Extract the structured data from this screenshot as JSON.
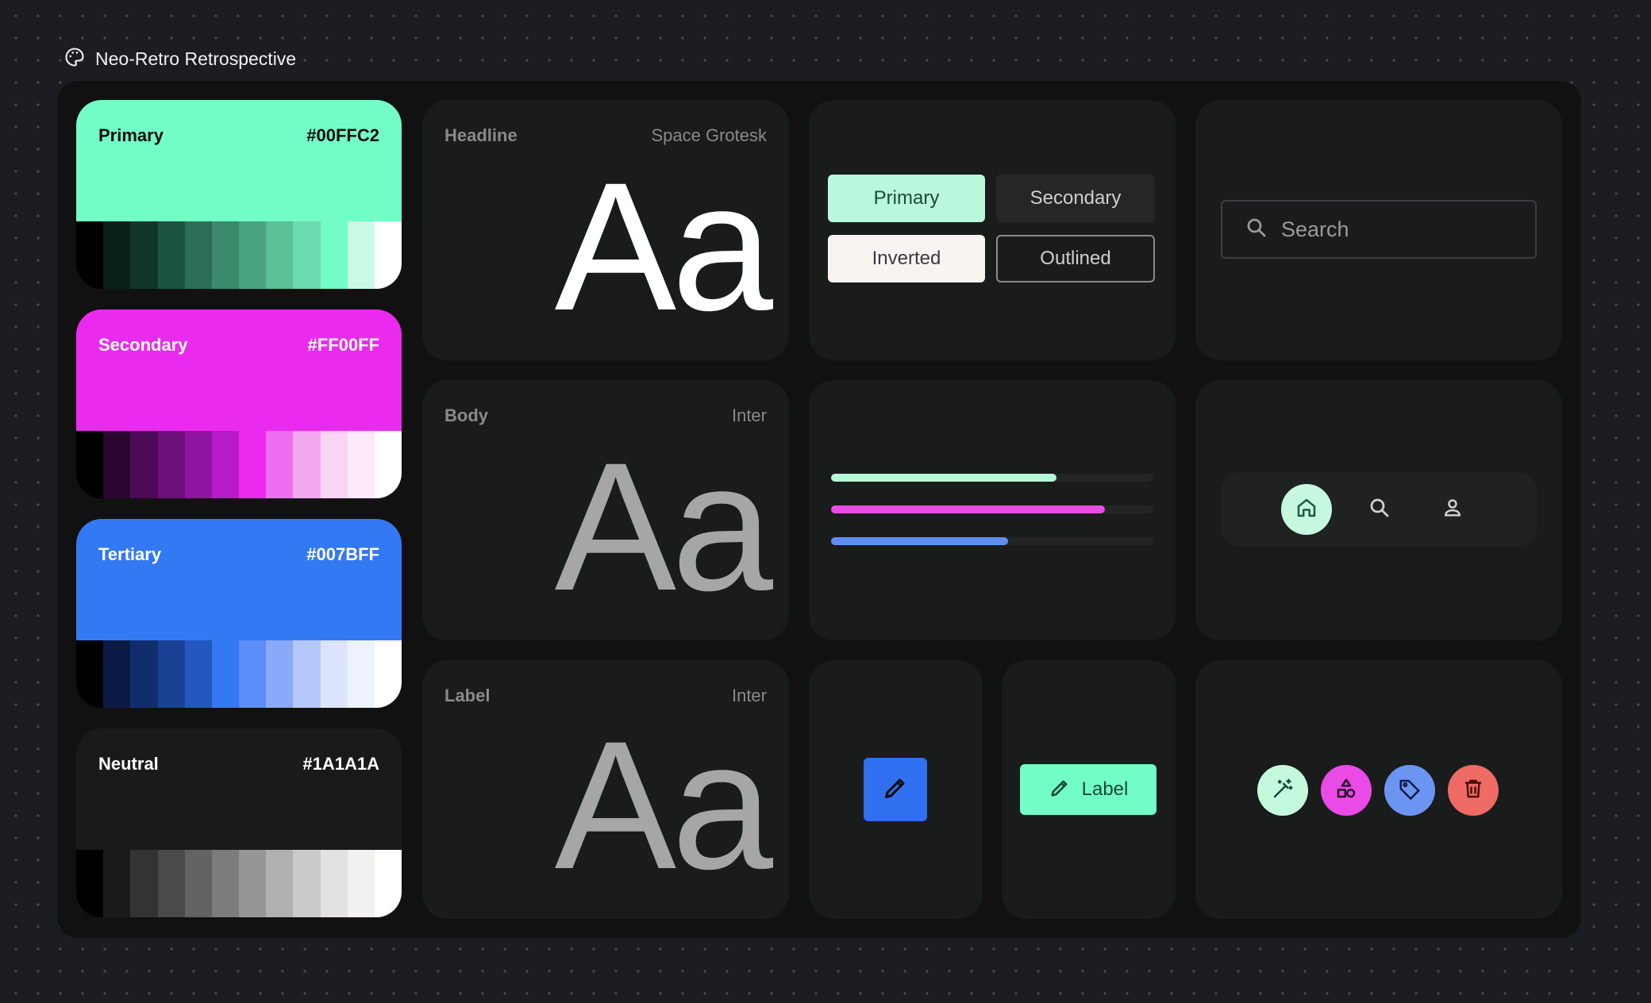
{
  "app_title": "Neo-Retro Retrospective",
  "swatches": [
    {
      "name": "Primary",
      "hex": "#00FFC2",
      "main": "#72fcc6",
      "text": "#0d0d0d",
      "tones": [
        "#000000",
        "#082017",
        "#11352a",
        "#1d5441",
        "#2c6f56",
        "#3a8a6b",
        "#4aa380",
        "#5ac095",
        "#6cdcb0",
        "#72fcc6",
        "#c9fbe6",
        "#ffffff"
      ]
    },
    {
      "name": "Secondary",
      "hex": "#FF00FF",
      "main": "#eb2af0",
      "text": "#ffffff",
      "tones": [
        "#000000",
        "#2a0630",
        "#4b0a56",
        "#6d0f7a",
        "#8f15a0",
        "#b51cc7",
        "#eb2af0",
        "#ef6df0",
        "#f3a9f0",
        "#f8d4f5",
        "#fceafa",
        "#ffffff"
      ]
    },
    {
      "name": "Tertiary",
      "hex": "#007BFF",
      "main": "#3479f4",
      "text": "#ffffff",
      "tones": [
        "#000000",
        "#0b1b45",
        "#112d6c",
        "#1a4093",
        "#2458be",
        "#3479f4",
        "#5c8df8",
        "#8aa9fa",
        "#b6c8fb",
        "#dce4fd",
        "#eef2fe",
        "#ffffff"
      ]
    },
    {
      "name": "Neutral",
      "hex": "#1A1A1A",
      "main": "#1a1a1a",
      "text": "#ffffff",
      "tones": [
        "#000000",
        "#1a1a1a",
        "#333333",
        "#4a4a4a",
        "#636363",
        "#7c7c7c",
        "#969696",
        "#b0b0b0",
        "#cacaca",
        "#e4e2e1",
        "#f3f1f0",
        "#ffffff"
      ]
    }
  ],
  "typography": [
    {
      "label": "Headline",
      "font": "Space Grotesk",
      "sample": "Aa",
      "color": "#ffffff"
    },
    {
      "label": "Body",
      "font": "Inter",
      "sample": "Aa",
      "color": "#a6a6a6"
    },
    {
      "label": "Label",
      "font": "Inter",
      "sample": "Aa",
      "color": "#a6a6a6"
    }
  ],
  "buttons": {
    "primary": "Primary",
    "secondary": "Secondary",
    "inverted": "Inverted",
    "outlined": "Outlined"
  },
  "search": {
    "placeholder": "Search",
    "icon": "search-icon"
  },
  "progress": [
    {
      "value": 0.7,
      "color": "#b6f7d8"
    },
    {
      "value": 0.85,
      "color": "#e94ce3"
    },
    {
      "value": 0.55,
      "color": "#5f8ef0"
    }
  ],
  "nav": {
    "items": [
      "home-icon",
      "search-icon",
      "person-icon"
    ],
    "active": 0,
    "active_color": "#c6f8e0"
  },
  "fab": {
    "icon": "pencil-icon",
    "color": "#2f6ff0"
  },
  "label_button": {
    "label": "Label",
    "icon": "pencil-icon",
    "color": "#72fcc6"
  },
  "icon_buttons": [
    {
      "icon": "magic-wand-icon",
      "color": "#c4f9de"
    },
    {
      "icon": "shapes-icon",
      "color": "#ea4ae6"
    },
    {
      "icon": "tag-icon",
      "color": "#6c95f2"
    },
    {
      "icon": "trash-icon",
      "color": "#ee6b66"
    }
  ]
}
